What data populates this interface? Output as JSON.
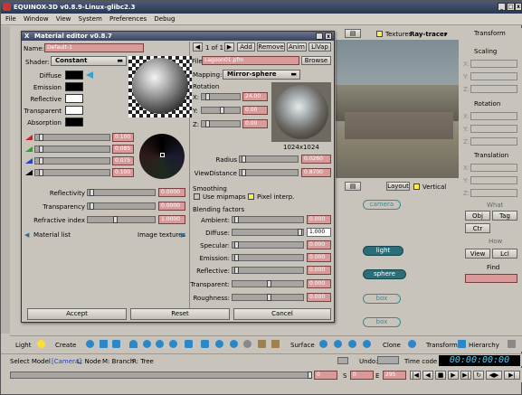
{
  "app": {
    "title": "EQUINOX-3D v0.8.9-Linux-glibc2.3"
  },
  "menu": [
    "File",
    "Window",
    "View",
    "System",
    "Preferences",
    "Debug"
  ],
  "viewport_header": {
    "textures_label": "Textures",
    "renderer": "Ray-tracer",
    "renderer_arrow": "▾"
  },
  "transform_panel": {
    "title": "Transform",
    "scaling": "Scaling",
    "rotation": "Rotation",
    "translation": "Translation",
    "axes": [
      "X:",
      "Y:",
      "Z:"
    ],
    "what": "What",
    "obj": "Obj",
    "tag": "Tag",
    "ctr": "Ctr",
    "how": "How",
    "view": "View",
    "lcl": "Lcl",
    "find": "Find"
  },
  "schematic": {
    "layout": "Layout",
    "vertical": "Vertical",
    "nodes": [
      "camera",
      "light",
      "sphere",
      "box",
      "box"
    ]
  },
  "dialog": {
    "title": "Material editor v0.8.7",
    "name_label": "Name:",
    "name_value": "Default-1",
    "shader_label": "Shader:",
    "shader_value": "Constant",
    "colors": [
      {
        "label": "Diffuse",
        "color": "#000000"
      },
      {
        "label": "Emission",
        "color": "#000000"
      },
      {
        "label": "Reflective",
        "color": "#ffffff"
      },
      {
        "label": "Transparent",
        "color": "#ffffff"
      },
      {
        "label": "Absorption",
        "color": "#000000"
      }
    ],
    "rgba": [
      {
        "value": "0.100",
        "color": "#cc2222"
      },
      {
        "value": "0.085",
        "color": "#22aa22"
      },
      {
        "value": "0.075",
        "color": "#2244cc"
      },
      {
        "value": "0.100",
        "color": "#000000"
      }
    ],
    "props": [
      {
        "label": "Reflectivity",
        "value": "0.0000"
      },
      {
        "label": "Transparency",
        "value": "0.0000"
      },
      {
        "label": "Refractive index",
        "value": "1.0000"
      }
    ],
    "material_list": "Material list",
    "image_textures": "Image textures",
    "page": "1 of 1",
    "btn_add": "Add",
    "btn_remove": "Remove",
    "btn_anim": "Anim",
    "btn_llvap": "LlVap",
    "file_label": "File",
    "file_value": "Lagoon01.pfm",
    "browse": "Browse",
    "mapping_label": "Mapping:",
    "mapping_value": "Mirror-sphere",
    "rotation_label": "Rotation",
    "rot": [
      {
        "axis": "X:",
        "value": "24.00"
      },
      {
        "axis": "Y:",
        "value": "0.00"
      },
      {
        "axis": "Z:",
        "value": "0.00"
      }
    ],
    "tex_size": "1024x1024",
    "radius_label": "Radius",
    "radius_value": "0.0260",
    "viewdist_label": "ViewDistance",
    "viewdist_value": "0.8700",
    "smoothing": "Smoothing",
    "use_mipmaps": "Use mipmaps",
    "pixel_interp": "Pixel interp.",
    "blending": "Blending factors",
    "blend": [
      {
        "label": "Ambient:",
        "value": "0.000"
      },
      {
        "label": "Diffuse:",
        "value": "1.000"
      },
      {
        "label": "Specular:",
        "value": "0.000"
      },
      {
        "label": "Emission:",
        "value": "0.000"
      },
      {
        "label": "Reflective:",
        "value": "0.000"
      },
      {
        "label": "Transparent:",
        "value": "0.000"
      },
      {
        "label": "Roughness:",
        "value": "0.000"
      }
    ],
    "accept": "Accept",
    "reset": "Reset",
    "cancel": "Cancel"
  },
  "toolbar": {
    "light": "Light",
    "create": "Create",
    "surface": "Surface",
    "clone": "Clone",
    "transform": "Transform",
    "hierarchy": "Hierarchy"
  },
  "status": {
    "select_model": "Select Model",
    "camera": "[Camera]",
    "l_node": "L: Node",
    "m_branch": "M: Branch",
    "r_tree": "R: Tree",
    "undo": "Undo:",
    "timecode": "Time code",
    "timecode_value": "00:00:00:00"
  },
  "timeline": {
    "frame": "0",
    "s_label": "S",
    "s_value": "0",
    "e_label": "E",
    "e_value": "295"
  }
}
